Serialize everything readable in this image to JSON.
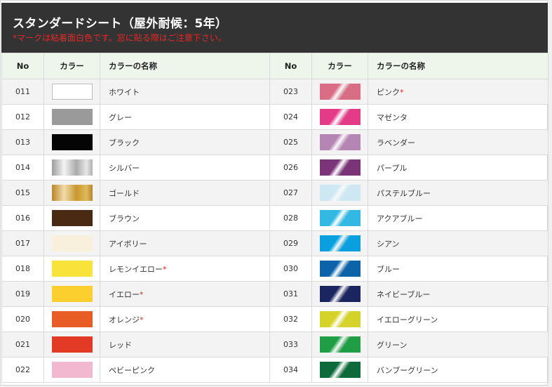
{
  "header": {
    "title": "スタンダードシート（屋外耐候：5年）",
    "note": "*マークは粘着面白色です。窓に貼る際はご注意下さい。"
  },
  "table": {
    "headers": {
      "no": "No",
      "color": "カラー",
      "name": "カラーの名称"
    },
    "left": [
      {
        "no": "011",
        "name": "ホワイト",
        "star": "",
        "color": "#ffffff",
        "style": "white"
      },
      {
        "no": "012",
        "name": "グレー",
        "star": "",
        "color": "#9a9a9a",
        "style": "solid"
      },
      {
        "no": "013",
        "name": "ブラック",
        "star": "",
        "color": "#050505",
        "style": "solid"
      },
      {
        "no": "014",
        "name": "シルバー",
        "star": "",
        "color": "#c8c8c8",
        "style": "silver"
      },
      {
        "no": "015",
        "name": "ゴールド",
        "star": "",
        "color": "#c9982e",
        "style": "gold"
      },
      {
        "no": "016",
        "name": "ブラウン",
        "star": "",
        "color": "#4a2a12",
        "style": "solid"
      },
      {
        "no": "017",
        "name": "アイボリー",
        "star": "",
        "color": "#f8efdc",
        "style": "solid"
      },
      {
        "no": "018",
        "name": "レモンイエロー",
        "star": "*",
        "color": "#f7e33a",
        "style": "solid"
      },
      {
        "no": "019",
        "name": "イエロー",
        "star": "*",
        "color": "#fbcf2e",
        "style": "solid"
      },
      {
        "no": "020",
        "name": "オレンジ",
        "star": "*",
        "color": "#e85c25",
        "style": "solid"
      },
      {
        "no": "021",
        "name": "レッド",
        "star": "",
        "color": "#e23a24",
        "style": "solid"
      },
      {
        "no": "022",
        "name": "ベビーピンク",
        "star": "",
        "color": "#f2b8cf",
        "style": "solid"
      }
    ],
    "right": [
      {
        "no": "023",
        "name": "ピンク",
        "star": "*",
        "color": "#d96d86",
        "style": "gloss"
      },
      {
        "no": "024",
        "name": "マゼンタ",
        "star": "",
        "color": "#e33b88",
        "style": "gloss"
      },
      {
        "no": "025",
        "name": "ラベンダー",
        "star": "",
        "color": "#b585b4",
        "style": "gloss"
      },
      {
        "no": "026",
        "name": "パープル",
        "star": "",
        "color": "#7a3477",
        "style": "gloss"
      },
      {
        "no": "027",
        "name": "パステルブルー",
        "star": "",
        "color": "#cde8f3",
        "style": "gloss"
      },
      {
        "no": "028",
        "name": "アクアブルー",
        "star": "",
        "color": "#33b7e3",
        "style": "gloss"
      },
      {
        "no": "029",
        "name": "シアン",
        "star": "",
        "color": "#0aa0df",
        "style": "gloss"
      },
      {
        "no": "030",
        "name": "ブルー",
        "star": "",
        "color": "#0c63a8",
        "style": "gloss"
      },
      {
        "no": "031",
        "name": "ネイビーブルー",
        "star": "",
        "color": "#1b2660",
        "style": "gloss"
      },
      {
        "no": "032",
        "name": "イエローグリーン",
        "star": "",
        "color": "#d5d22a",
        "style": "gloss"
      },
      {
        "no": "033",
        "name": "グリーン",
        "star": "",
        "color": "#1f9e45",
        "style": "gloss"
      },
      {
        "no": "034",
        "name": "バンブーグリーン",
        "star": "",
        "color": "#0e6a3a",
        "style": "gloss"
      }
    ]
  }
}
